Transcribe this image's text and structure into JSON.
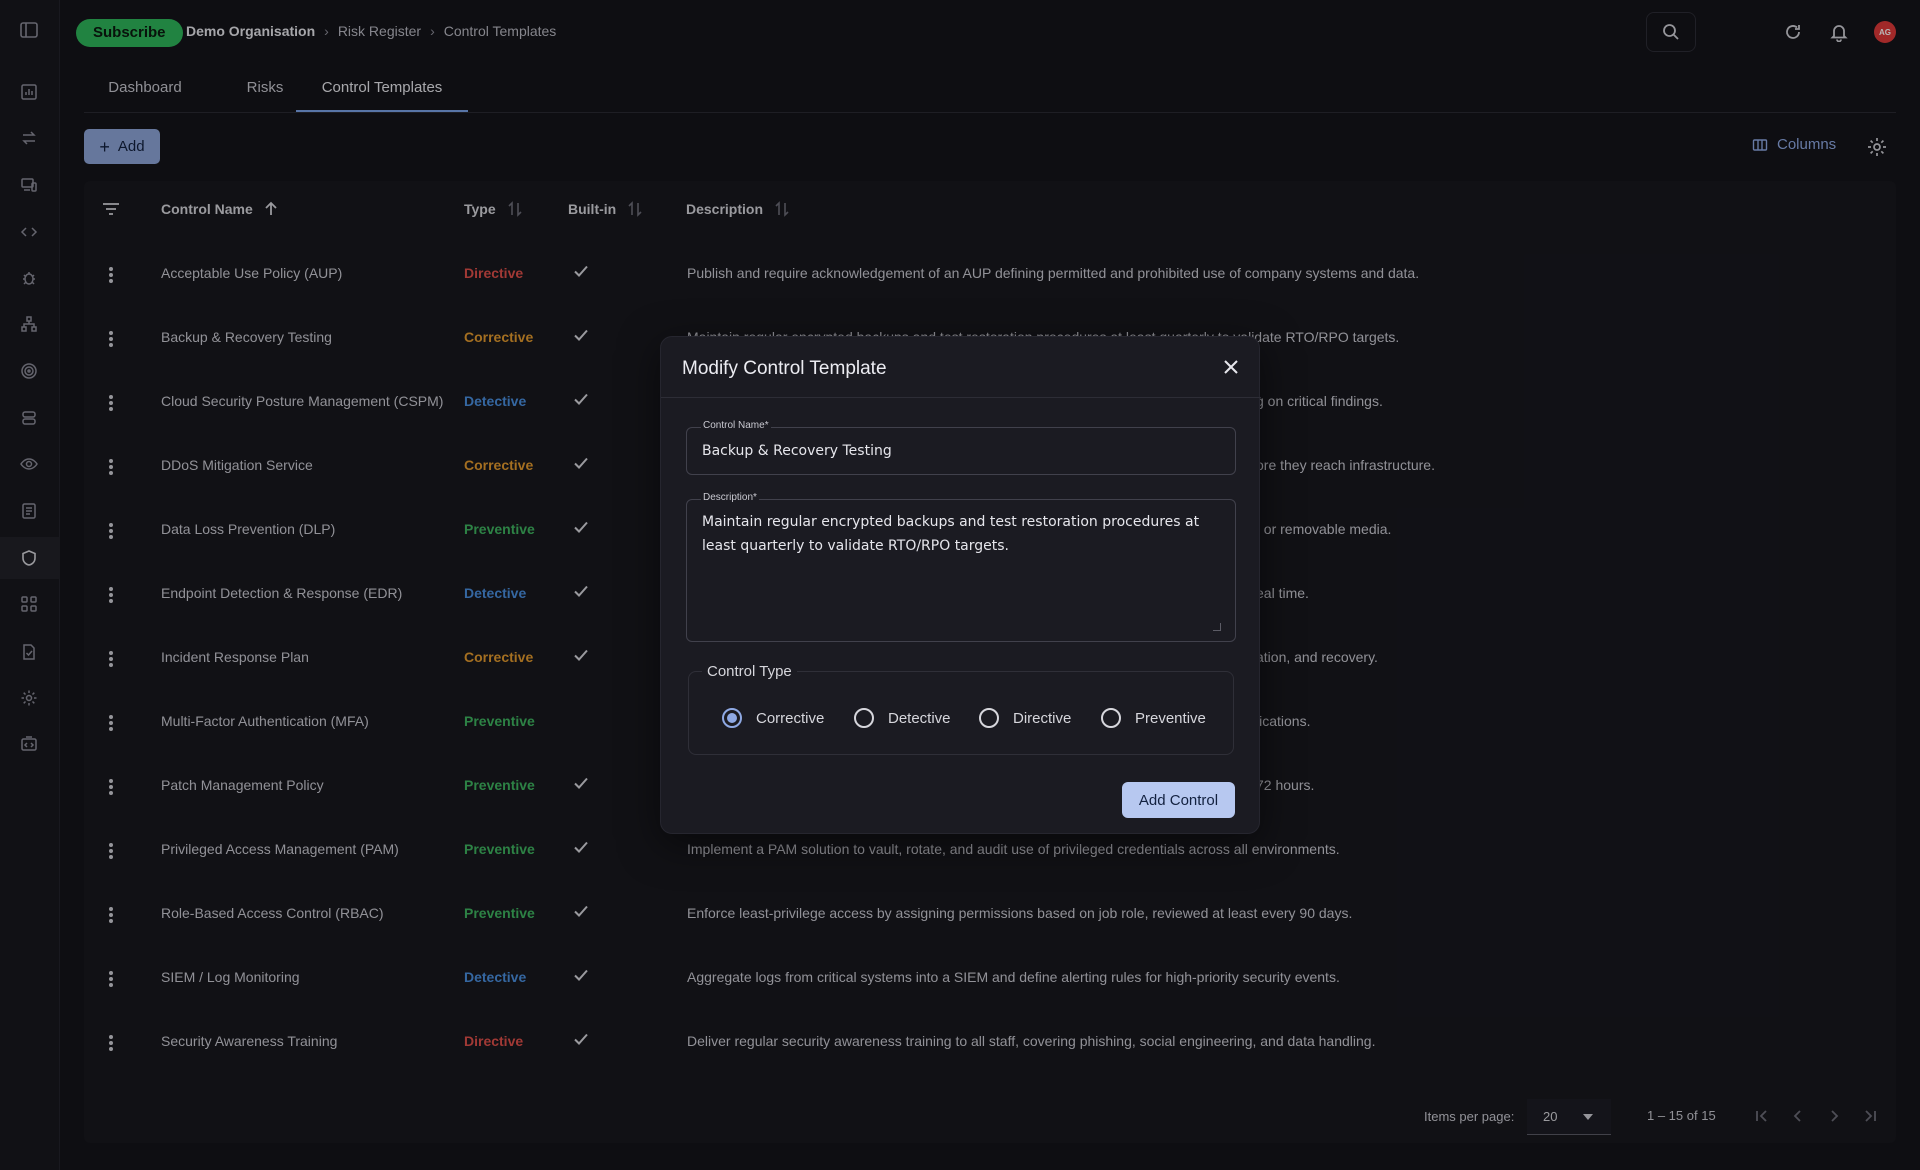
{
  "topbar": {
    "subscribe_label": "Subscribe",
    "breadcrumb": [
      "Demo Organisation",
      "Risk Register",
      "Control Templates"
    ],
    "avatar_initials": "AG"
  },
  "tabs": [
    {
      "label": "Dashboard",
      "active": false
    },
    {
      "label": "Risks",
      "active": false
    },
    {
      "label": "Control Templates",
      "active": true
    }
  ],
  "toolbar": {
    "add_label": "Add",
    "columns_label": "Columns"
  },
  "table": {
    "headers": {
      "name": "Control Name",
      "type": "Type",
      "builtin": "Built-in",
      "description": "Description"
    },
    "rows": [
      {
        "name": "Acceptable Use Policy (AUP)",
        "type": "Directive",
        "builtin": true,
        "description": "Publish and require acknowledgement of an AUP defining permitted and prohibited use of company systems and data."
      },
      {
        "name": "Backup & Recovery Testing",
        "type": "Corrective",
        "builtin": true,
        "description": "Maintain regular encrypted backups and test restoration procedures at least quarterly to validate RTO/RPO targets."
      },
      {
        "name": "Cloud Security Posture Management (CSPM)",
        "type": "Detective",
        "builtin": true,
        "description": "g on critical findings."
      },
      {
        "name": "DDoS Mitigation Service",
        "type": "Corrective",
        "builtin": true,
        "description": "ore they reach infrastructure."
      },
      {
        "name": "Data Loss Prevention (DLP)",
        "type": "Preventive",
        "builtin": true,
        "description": ", or removable media."
      },
      {
        "name": "Endpoint Detection & Response (EDR)",
        "type": "Detective",
        "builtin": true,
        "description": "eal time."
      },
      {
        "name": "Incident Response Plan",
        "type": "Corrective",
        "builtin": true,
        "description": "ation, and recovery."
      },
      {
        "name": "Multi-Factor Authentication (MFA)",
        "type": "Preventive",
        "builtin": false,
        "description": "lications."
      },
      {
        "name": "Patch Management Policy",
        "type": "Preventive",
        "builtin": true,
        "description": "72 hours."
      },
      {
        "name": "Privileged Access Management (PAM)",
        "type": "Preventive",
        "builtin": true,
        "description": "Implement a PAM solution to vault, rotate, and audit use of privileged credentials across all environments."
      },
      {
        "name": "Role-Based Access Control (RBAC)",
        "type": "Preventive",
        "builtin": true,
        "description": "Enforce least-privilege access by assigning permissions based on job role, reviewed at least every 90 days."
      },
      {
        "name": "SIEM / Log Monitoring",
        "type": "Detective",
        "builtin": true,
        "description": "Aggregate logs from critical systems into a SIEM and define alerting rules for high-priority security events."
      },
      {
        "name": "Security Awareness Training",
        "type": "Directive",
        "builtin": true,
        "description": "Deliver regular security awareness training to all staff, covering phishing, social engineering, and data handling."
      }
    ]
  },
  "type_colors": {
    "Directive": "#e0504a",
    "Corrective": "#e39a2e",
    "Detective": "#4a8fe0",
    "Preventive": "#3fb560"
  },
  "pagination": {
    "items_per_page_label": "Items per page:",
    "items_per_page": "20",
    "range": "1 – 15 of 15"
  },
  "modal": {
    "title": "Modify Control Template",
    "name_label": "Control Name*",
    "name_value": "Backup & Recovery Testing",
    "description_label": "Description*",
    "description_value": "Maintain regular encrypted backups and test restoration procedures at least quarterly to validate RTO/RPO targets.",
    "type_legend": "Control Type",
    "type_options": [
      "Corrective",
      "Detective",
      "Directive",
      "Preventive"
    ],
    "type_selected": "Corrective",
    "submit_label": "Add Control"
  }
}
